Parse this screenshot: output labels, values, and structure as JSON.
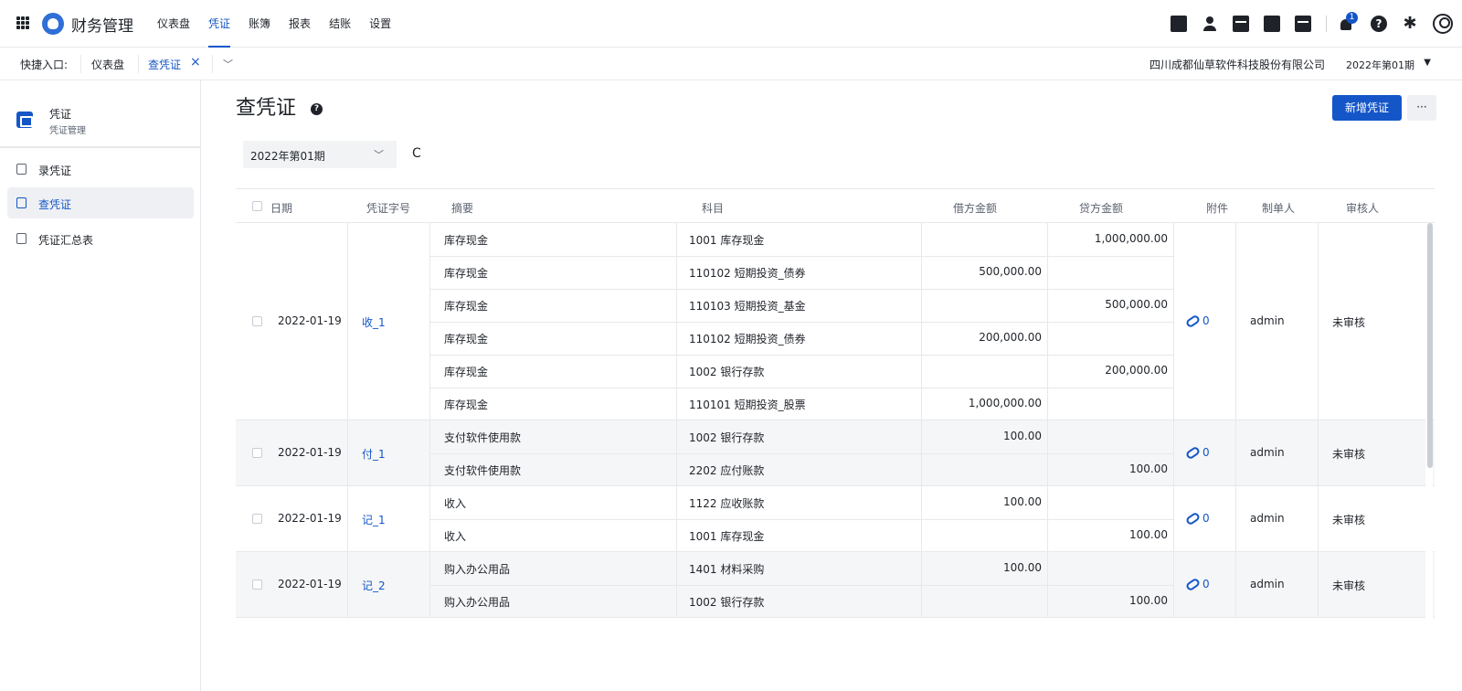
{
  "app": {
    "title": "财务管理",
    "nav": [
      "仪表盘",
      "凭证",
      "账簿",
      "报表",
      "结账",
      "设置"
    ],
    "active_nav": "凭证",
    "notification_count": "1"
  },
  "quickbar": {
    "label": "快捷入口:",
    "tabs": [
      "仪表盘",
      "查凭证"
    ],
    "close_glyph": "×",
    "company": "四川成都仙草软件科技股份有限公司",
    "period": "2022年第01期"
  },
  "sidebar": {
    "title": "凭证",
    "subtitle": "凭证管理",
    "items": [
      "录凭证",
      "查凭证",
      "凭证汇总表"
    ],
    "active": "查凭证"
  },
  "main": {
    "title": "查凭证",
    "new_button": "新增凭证",
    "more_button": "···",
    "period_select": "2022年第01期",
    "refresh_glyph": "C"
  },
  "table": {
    "columns": [
      "日期",
      "凭证字号",
      "摘要",
      "科目",
      "借方金额",
      "贷方金额",
      "附件",
      "制单人",
      "审核人"
    ],
    "groups": [
      {
        "date": "2022-01-19",
        "voucher": "收_1",
        "attachments": "0",
        "maker": "admin",
        "reviewer": "未审核",
        "rows": [
          {
            "summary": "库存现金",
            "account": "1001 库存现金",
            "debit": "",
            "credit": "1,000,000.00"
          },
          {
            "summary": "库存现金",
            "account": "110102 短期投资_债券",
            "debit": "500,000.00",
            "credit": ""
          },
          {
            "summary": "库存现金",
            "account": "110103 短期投资_基金",
            "debit": "",
            "credit": "500,000.00"
          },
          {
            "summary": "库存现金",
            "account": "110102 短期投资_债券",
            "debit": "200,000.00",
            "credit": ""
          },
          {
            "summary": "库存现金",
            "account": "1002 银行存款",
            "debit": "",
            "credit": "200,000.00"
          },
          {
            "summary": "库存现金",
            "account": "110101 短期投资_股票",
            "debit": "1,000,000.00",
            "credit": ""
          }
        ]
      },
      {
        "date": "2022-01-19",
        "voucher": "付_1",
        "attachments": "0",
        "maker": "admin",
        "reviewer": "未审核",
        "rows": [
          {
            "summary": "支付软件使用款",
            "account": "1002 银行存款",
            "debit": "100.00",
            "credit": ""
          },
          {
            "summary": "支付软件使用款",
            "account": "2202 应付账款",
            "debit": "",
            "credit": "100.00"
          }
        ]
      },
      {
        "date": "2022-01-19",
        "voucher": "记_1",
        "attachments": "0",
        "maker": "admin",
        "reviewer": "未审核",
        "rows": [
          {
            "summary": "收入",
            "account": "1122 应收账款",
            "debit": "100.00",
            "credit": ""
          },
          {
            "summary": "收入",
            "account": "1001 库存现金",
            "debit": "",
            "credit": "100.00"
          }
        ]
      },
      {
        "date": "2022-01-19",
        "voucher": "记_2",
        "attachments": "0",
        "maker": "admin",
        "reviewer": "未审核",
        "rows": [
          {
            "summary": "购入办公用品",
            "account": "1401 材料采购",
            "debit": "100.00",
            "credit": ""
          },
          {
            "summary": "购入办公用品",
            "account": "1002 银行存款",
            "debit": "",
            "credit": "100.00"
          }
        ]
      }
    ]
  },
  "colors": {
    "accent": "#1456c8",
    "border": "#e6e8eb",
    "alt_row": "#f5f6f7"
  }
}
